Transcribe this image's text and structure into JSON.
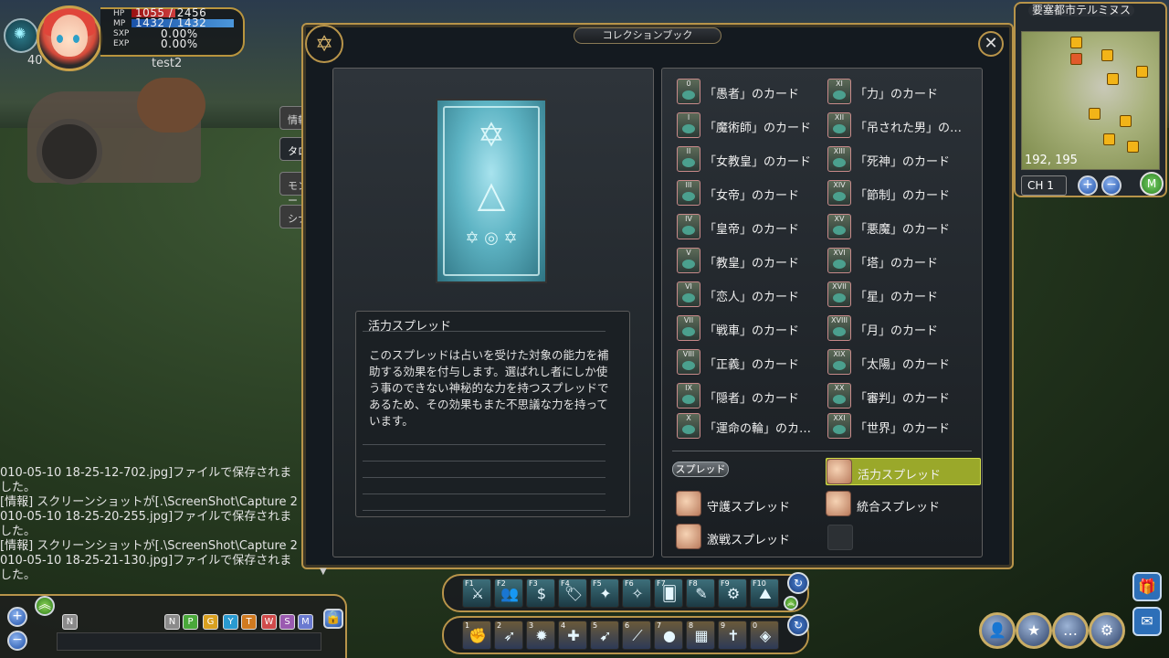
{
  "player": {
    "level": "40",
    "name": "test2",
    "hp_label": "HP",
    "hp_value": "1055 / 2456",
    "mp_label": "MP",
    "mp_value": "1432 / 1432",
    "sxp_label": "SXP",
    "sxp_value": "0.00%",
    "exp_label": "EXP",
    "exp_value": "0.00%",
    "hp_ratio": 0.43,
    "mp_ratio": 1.0
  },
  "window": {
    "title": "コレクションブック",
    "close_glyph": "✕",
    "emblem_glyph": "✡"
  },
  "side_tabs": [
    {
      "label": "情報"
    },
    {
      "label": "タロット"
    },
    {
      "label": "モンスター"
    },
    {
      "label": "シナリオ"
    }
  ],
  "selected": {
    "title": "活力スプレッド",
    "description": "このスプレッドは占いを受けた対象の能力を補助する効果を付与します。選ばれし者にしか使う事のできない神秘的な力を持つスプレッドであるため、その効果もまた不思議な力を持っています。"
  },
  "tarot_left": [
    {
      "num": "0",
      "label": "「愚者」のカード"
    },
    {
      "num": "I",
      "label": "「魔術師」のカード"
    },
    {
      "num": "II",
      "label": "「女教皇」のカード"
    },
    {
      "num": "III",
      "label": "「女帝」のカード"
    },
    {
      "num": "IV",
      "label": "「皇帝」のカード"
    },
    {
      "num": "V",
      "label": "「教皇」のカード"
    },
    {
      "num": "VI",
      "label": "「恋人」のカード"
    },
    {
      "num": "VII",
      "label": "「戦車」のカード"
    },
    {
      "num": "VIII",
      "label": "「正義」のカード"
    },
    {
      "num": "IX",
      "label": "「隠者」のカード"
    },
    {
      "num": "X",
      "label": "「運命の輪」のカ…"
    }
  ],
  "tarot_right": [
    {
      "num": "XI",
      "label": "「力」のカード"
    },
    {
      "num": "XII",
      "label": "「吊された男」の…"
    },
    {
      "num": "XIII",
      "label": "「死神」のカード"
    },
    {
      "num": "XIV",
      "label": "「節制」のカード"
    },
    {
      "num": "XV",
      "label": "「悪魔」のカード"
    },
    {
      "num": "XVI",
      "label": "「塔」のカード"
    },
    {
      "num": "XVII",
      "label": "「星」のカード"
    },
    {
      "num": "XVIII",
      "label": "「月」のカード"
    },
    {
      "num": "XIX",
      "label": "「太陽」のカード"
    },
    {
      "num": "XX",
      "label": "「審判」のカード"
    },
    {
      "num": "XXI",
      "label": "「世界」のカード"
    }
  ],
  "spread": {
    "header": "スプレッド",
    "items": [
      {
        "label": "活力スプレッド",
        "selected": true
      },
      {
        "label": "守護スプレッド",
        "selected": false
      },
      {
        "label": "統合スプレッド",
        "selected": false
      },
      {
        "label": "激戦スプレッド",
        "selected": false
      }
    ]
  },
  "minimap": {
    "title": "要塞都市テルミヌス",
    "coords": "192, 195",
    "channel_label": "CH",
    "channel_value": "1",
    "zoom_in": "+",
    "zoom_out": "−",
    "map_button": "M"
  },
  "chat": {
    "lines": [
      "010-05-10 18-25-12-702.jpg]ファイルで保存されま",
      "した。",
      "[情報] スクリーンショットが[.\\ScreenShot\\Capture 2",
      "010-05-10 18-25-20-255.jpg]ファイルで保存されま",
      "した。",
      "[情報] スクリーンショットが[.\\ScreenShot\\Capture 2",
      "010-05-10 18-25-21-130.jpg]ファイルで保存されま",
      "した。"
    ],
    "channels": [
      {
        "key": "N",
        "color": "#8a8a8a"
      },
      {
        "key": "N",
        "color": "#8a8a8a"
      },
      {
        "key": "P",
        "color": "#4aa83a"
      },
      {
        "key": "G",
        "color": "#d9a020"
      },
      {
        "key": "Y",
        "color": "#2a9ad0"
      },
      {
        "key": "T",
        "color": "#d07a20"
      },
      {
        "key": "W",
        "color": "#d04a4a"
      },
      {
        "key": "S",
        "color": "#9a5ab0"
      },
      {
        "key": "M",
        "color": "#6a7ad0"
      }
    ]
  },
  "skillbar1": [
    {
      "key": "F1",
      "glyph": "⚔"
    },
    {
      "key": "F2",
      "glyph": "👥"
    },
    {
      "key": "F3",
      "glyph": "$"
    },
    {
      "key": "F4",
      "glyph": "🏷"
    },
    {
      "key": "F5",
      "glyph": "✦"
    },
    {
      "key": "F6",
      "glyph": "✧"
    },
    {
      "key": "F7",
      "glyph": "🂠"
    },
    {
      "key": "F8",
      "glyph": "✎"
    },
    {
      "key": "F9",
      "glyph": "⚙"
    },
    {
      "key": "F10",
      "glyph": "⛰"
    }
  ],
  "skillbar2": [
    {
      "key": "1",
      "glyph": "✊"
    },
    {
      "key": "2",
      "glyph": "➶"
    },
    {
      "key": "3",
      "glyph": "✹"
    },
    {
      "key": "4",
      "glyph": "✚"
    },
    {
      "key": "5",
      "glyph": "➹"
    },
    {
      "key": "6",
      "glyph": "⟋"
    },
    {
      "key": "7",
      "glyph": "●"
    },
    {
      "key": "8",
      "glyph": "▦"
    },
    {
      "key": "9",
      "glyph": "✝"
    },
    {
      "key": "0",
      "glyph": "◈"
    }
  ],
  "menu_buttons": [
    {
      "glyph": "👤"
    },
    {
      "glyph": "★"
    },
    {
      "glyph": "…"
    },
    {
      "glyph": "⚙"
    }
  ]
}
